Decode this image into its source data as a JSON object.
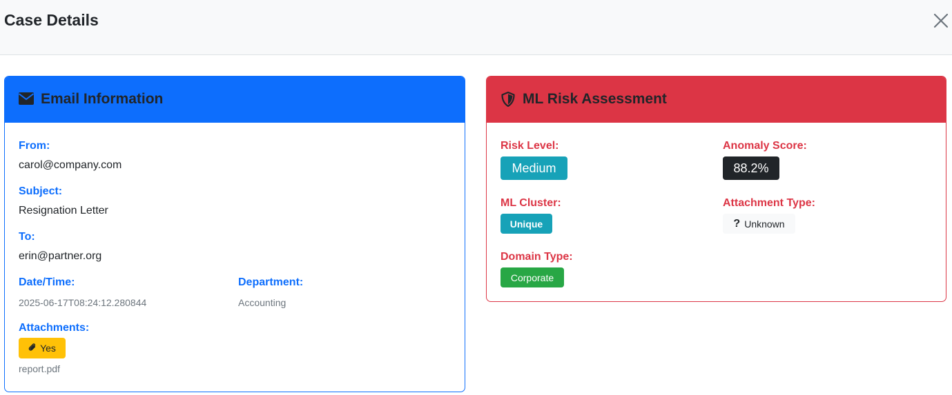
{
  "modal": {
    "title": "Case Details"
  },
  "email_card": {
    "title": "Email Information",
    "from_label": "From:",
    "from_value": "carol@company.com",
    "subject_label": "Subject:",
    "subject_value": "Resignation Letter",
    "to_label": "To:",
    "to_value": "erin@partner.org",
    "datetime_label": "Date/Time:",
    "datetime_value": "2025-06-17T08:24:12.280844",
    "department_label": "Department:",
    "department_value": "Accounting",
    "attachments_label": "Attachments:",
    "attachments_badge": "Yes",
    "attachment_file": "report.pdf"
  },
  "risk_card": {
    "title": "ML Risk Assessment",
    "risk_level_label": "Risk Level:",
    "risk_level_value": "Medium",
    "anomaly_label": "Anomaly Score:",
    "anomaly_value": "88.2%",
    "cluster_label": "ML Cluster:",
    "cluster_value": "Unique",
    "attachment_type_label": "Attachment Type:",
    "attachment_type_value": "Unknown",
    "domain_type_label": "Domain Type:",
    "domain_type_value": "Corporate"
  },
  "icons": {
    "email_header": "envelope-icon",
    "risk_header": "shield-icon",
    "close": "close-icon",
    "attachment": "paperclip-icon",
    "unknown": "question-icon"
  },
  "colors": {
    "primary": "#0d6efd",
    "danger": "#dc3545",
    "info": "#17a2b8",
    "dark": "#212529",
    "warning": "#ffc107",
    "success": "#28a745"
  }
}
